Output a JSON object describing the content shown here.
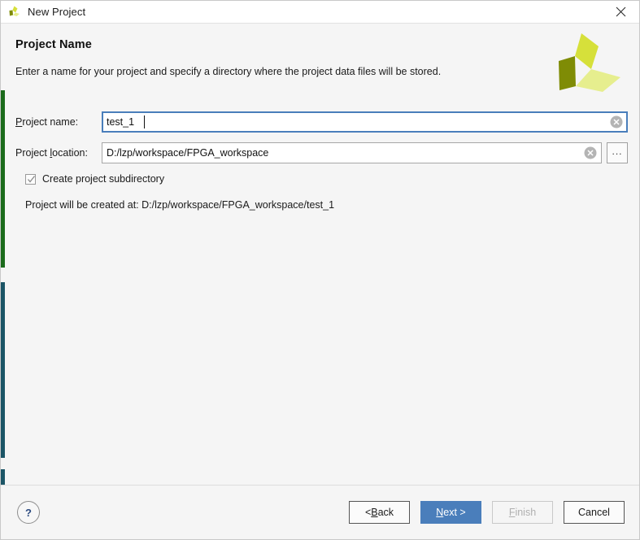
{
  "titlebar": {
    "title": "New Project",
    "app_icon": "xilinx-logo-icon",
    "close_icon": "close-icon"
  },
  "header": {
    "title": "Project Name",
    "subtitle": "Enter a name for your project and specify a directory where the project data files will be stored.",
    "logo_icon": "xilinx-brand-logo"
  },
  "form": {
    "project_name": {
      "label_pre": "P",
      "label_post": "roject name:",
      "value": "test_1",
      "placeholder": "",
      "clear_icon": "clear-circle-icon"
    },
    "project_location": {
      "label_pre": "Project ",
      "label_mn": "l",
      "label_post": "ocation:",
      "value": "D:/lzp/workspace/FPGA_workspace",
      "placeholder": "",
      "clear_icon": "clear-circle-icon",
      "browse_label": "..."
    },
    "create_subdirectory": {
      "label": "Create project subdirectory",
      "checked": true
    },
    "status": "Project will be created at: D:/lzp/workspace/FPGA_workspace/test_1"
  },
  "footer": {
    "help_label": "?",
    "buttons": {
      "back": {
        "pre": "< ",
        "mn": "B",
        "post": "ack"
      },
      "next": {
        "pre": "",
        "mn": "N",
        "post": "ext >"
      },
      "finish": {
        "pre": "",
        "mn": "F",
        "post": "inish"
      },
      "cancel": {
        "pre": "",
        "mn": "",
        "post": "Cancel"
      }
    }
  },
  "colors": {
    "accent_blue": "#4a7ebb",
    "accent_green": "#1b6b1b",
    "accent_teal": "#1b5566",
    "brand_olive": "#7f8c05",
    "brand_yellow": "#d6e03a",
    "brand_light": "#e6ee8e"
  }
}
